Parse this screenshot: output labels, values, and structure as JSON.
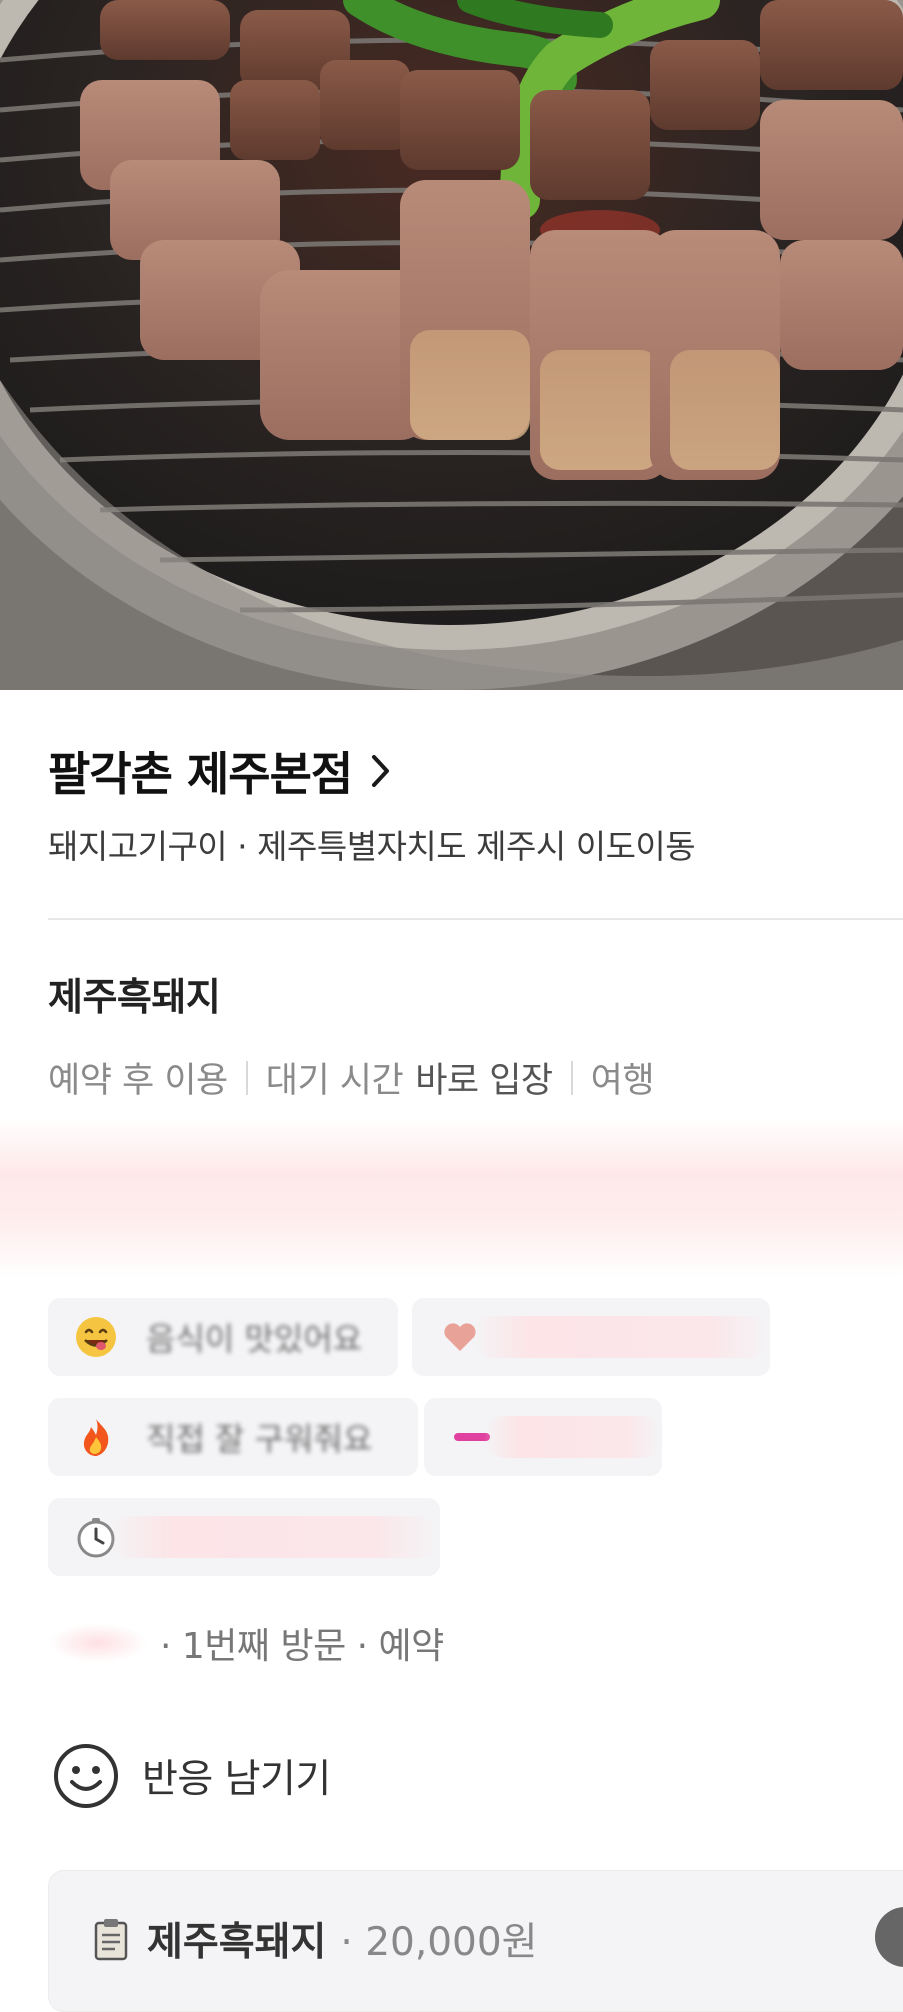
{
  "hero": {
    "image_alt_name": "grilled-pork-photo"
  },
  "place": {
    "title": "팔각촌 제주본점",
    "subtitle": "돼지고기구이 · 제주특별자치도 제주시 이도이동"
  },
  "review": {
    "menu_title": "제주흑돼지",
    "meta": {
      "reservation": "예약 후 이용",
      "wait_label": "대기 시간",
      "wait_value": "바로 입장",
      "purpose": "여행"
    },
    "keyword_chips": [
      {
        "emoji": "yum-face-icon",
        "text": "음식이 맛있어요"
      },
      {
        "emoji": "heart-icon",
        "text": ""
      },
      {
        "emoji": "fire-icon",
        "text": "직접 잘 구워줘요"
      },
      {
        "emoji": "pink-icon",
        "text": ""
      },
      {
        "emoji": "clock-icon",
        "text": ""
      }
    ],
    "visit_info": "· 1번째 방문 · 예약",
    "reaction_label": "반응 남기기",
    "menu_card": {
      "name": "제주흑돼지",
      "price": "· 20,000원"
    }
  }
}
